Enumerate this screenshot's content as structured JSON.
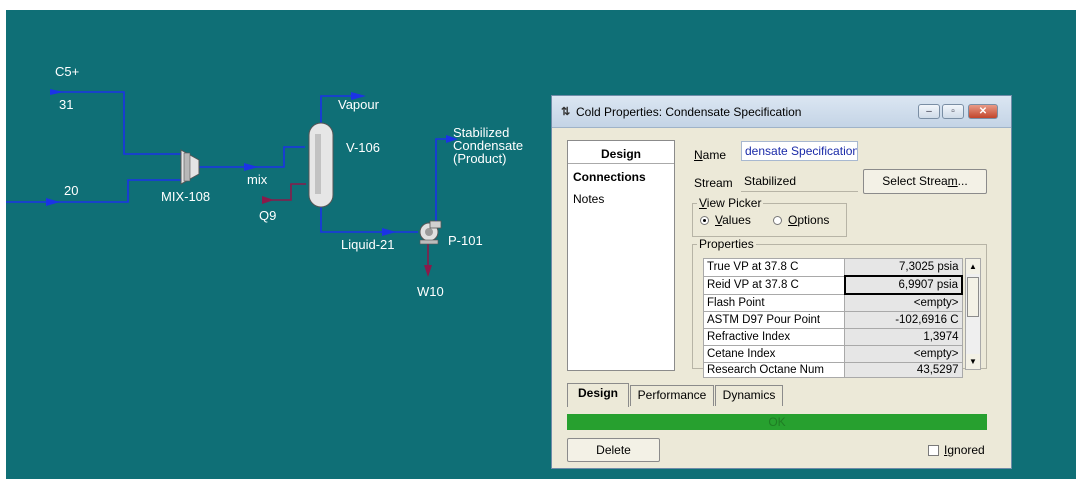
{
  "flowsheet": {
    "streams": {
      "c5plus": "C5+",
      "s31": "31",
      "s20": "20",
      "mix": "mix",
      "vapour": "Vapour",
      "q9": "Q9",
      "liquid21": "Liquid-21",
      "w10": "W10",
      "product_line1": "Stabilized",
      "product_line2": "Condensate",
      "product_line3": "(Product)"
    },
    "units": {
      "mixer": "MIX-108",
      "column": "V-106",
      "pump": "P-101"
    },
    "colors": {
      "background": "#0f6f76",
      "stream_material": "#1b33e6",
      "stream_energy": "#8a1a4a",
      "label": "#ffffff"
    }
  },
  "dialog": {
    "title": "Cold Properties: Condensate Specification",
    "title_icon": "hysys-icon",
    "window_buttons": [
      "minimize",
      "maximize",
      "close"
    ],
    "nav": {
      "header": "Design",
      "items": [
        "Connections",
        "Notes"
      ],
      "selected": "Connections"
    },
    "name_label": "Name",
    "name_value": "densate Specification",
    "stream_label": "Stream",
    "stream_value": "Stabilized",
    "select_stream_button": "Select Stream...",
    "view_picker": {
      "title": "View Picker",
      "options": [
        "Values",
        "Options"
      ],
      "selected": "Values"
    },
    "properties": {
      "title": "Properties",
      "rows": [
        {
          "name": "True VP at 37.8 C",
          "value": "7,3025 psia"
        },
        {
          "name": "Reid VP at 37.8 C",
          "value": "6,9907 psia"
        },
        {
          "name": "Flash Point",
          "value": "<empty>"
        },
        {
          "name": "ASTM D97 Pour Point",
          "value": "-102,6916 C"
        },
        {
          "name": "Refractive Index",
          "value": "1,3974"
        },
        {
          "name": "Cetane Index",
          "value": "<empty>"
        },
        {
          "name": "Research Octane Num",
          "value": "43,5297"
        }
      ],
      "selected_row": 1
    },
    "tabs": [
      "Design",
      "Performance",
      "Dynamics"
    ],
    "active_tab": "Design",
    "status": "OK",
    "status_color": "#27a02f",
    "delete_button": "Delete",
    "ignored_label": "Ignored",
    "ignored_checked": false
  }
}
